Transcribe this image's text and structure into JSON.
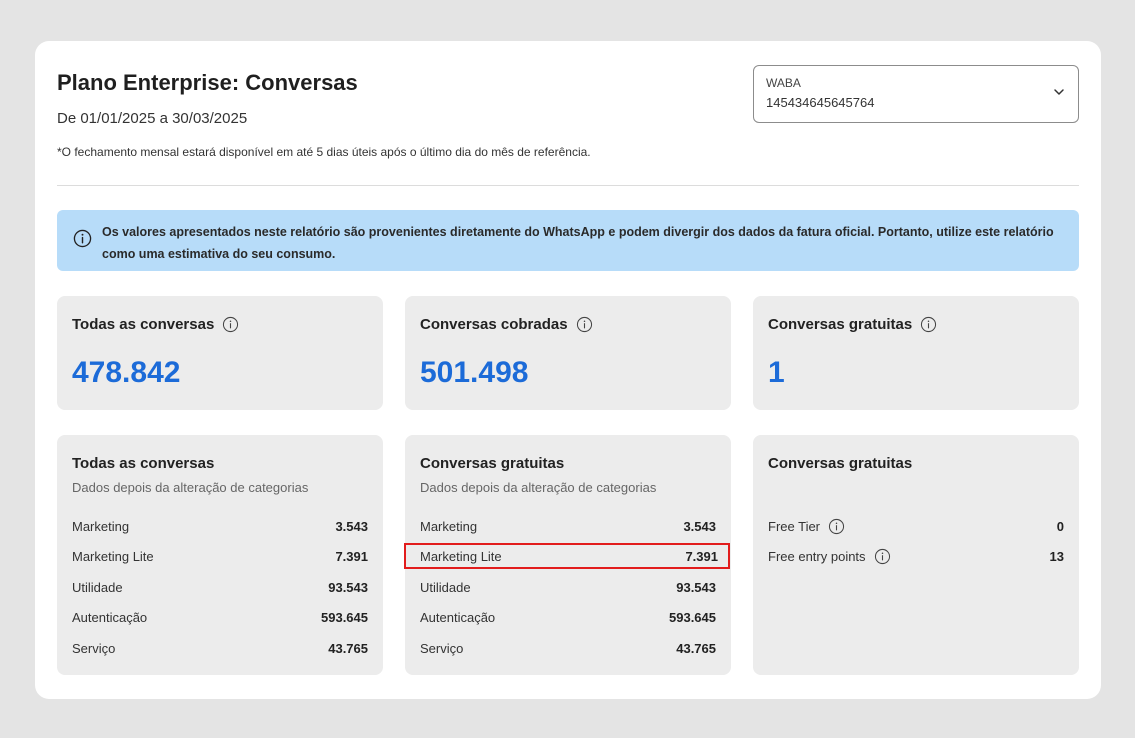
{
  "header": {
    "title": "Plano Enterprise: Conversas",
    "period": "De 01/01/2025 a 30/03/2025",
    "footnote": "*O fechamento mensal estará disponível em até 5 dias úteis após o último dia do mês de referência."
  },
  "waba_select": {
    "label": "WABA",
    "value": "145434645645764"
  },
  "alert": {
    "text": "Os valores apresentados neste relatório são provenientes diretamente do WhatsApp e podem divergir dos dados da fatura oficial. Portanto, utilize este relatório como uma estimativa do seu consumo."
  },
  "stats": [
    {
      "label": "Todas as conversas",
      "value": "478.842"
    },
    {
      "label": "Conversas cobradas",
      "value": "501.498"
    },
    {
      "label": "Conversas gratuitas",
      "value": "1"
    }
  ],
  "panels": [
    {
      "title": "Todas as conversas",
      "subtitle": "Dados depois da alteração de categorias",
      "rows": [
        {
          "label": "Marketing",
          "value": "3.543"
        },
        {
          "label": "Marketing Lite",
          "value": "7.391"
        },
        {
          "label": "Utilidade",
          "value": "93.543"
        },
        {
          "label": "Autenticação",
          "value": "593.645"
        },
        {
          "label": "Serviço",
          "value": "43.765"
        }
      ]
    },
    {
      "title": "Conversas gratuitas",
      "subtitle": "Dados depois da alteração de categorias",
      "rows": [
        {
          "label": "Marketing",
          "value": "3.543"
        },
        {
          "label": "Marketing Lite",
          "value": "7.391"
        },
        {
          "label": "Utilidade",
          "value": "93.543"
        },
        {
          "label": "Autenticação",
          "value": "593.645"
        },
        {
          "label": "Serviço",
          "value": "43.765"
        }
      ]
    },
    {
      "title": "Conversas gratuitas",
      "rows": [
        {
          "label": "Free Tier",
          "value": "0"
        },
        {
          "label": "Free entry points",
          "value": "13"
        }
      ]
    }
  ],
  "colors": {
    "accent": "#1c6bd8",
    "alert_bg": "#b7dcf9",
    "highlight": "#e21c1c"
  },
  "icons": {
    "info": "info-circle-icon",
    "chevron": "chevron-down-icon"
  }
}
